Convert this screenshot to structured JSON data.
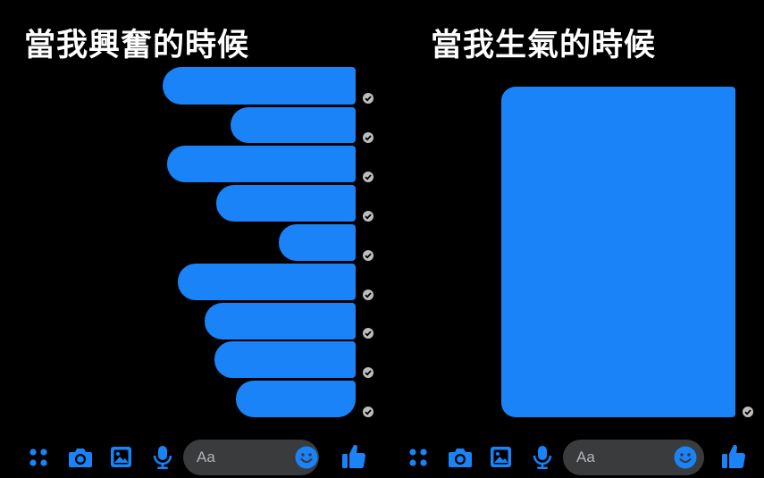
{
  "titles": {
    "left": "當我興奮的時候",
    "right": "當我生氣的時候"
  },
  "colors": {
    "bubble": "#1a83f8",
    "background": "#000000",
    "icon": "#1a83f8",
    "input_pill": "#3a3b3d",
    "check": "#bdbdbd"
  },
  "composer": {
    "left": {
      "placeholder": "Aa",
      "icons": [
        "apps-icon",
        "camera-icon",
        "image-icon",
        "mic-icon",
        "emoji-icon",
        "thumbs-up-icon"
      ]
    },
    "right": {
      "placeholder": "Aa",
      "icons": [
        "apps-icon",
        "camera-icon",
        "image-icon",
        "mic-icon",
        "emoji-icon",
        "thumbs-up-icon"
      ]
    }
  },
  "left_messages_count": 9,
  "right_messages_count": 1,
  "message_status": "sent"
}
